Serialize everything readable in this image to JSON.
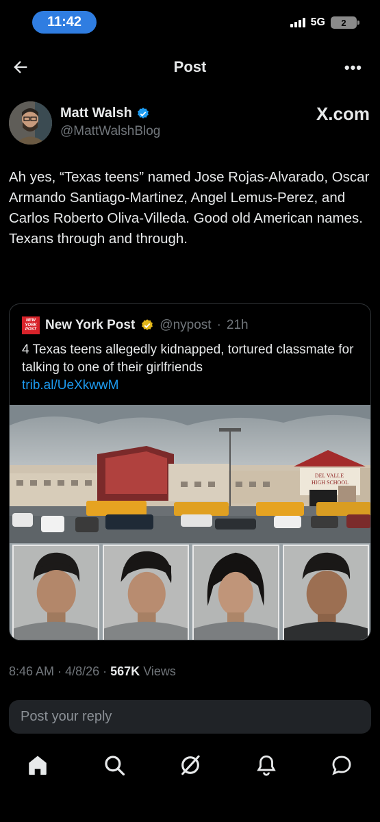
{
  "status_bar": {
    "time": "11:42",
    "network": "5G",
    "battery": "2"
  },
  "nav": {
    "title": "Post"
  },
  "author": {
    "name": "Matt Walsh",
    "handle": "@MattWalshBlog",
    "source_label": "X.com"
  },
  "post": {
    "text": "Ah yes, “Texas teens” named Jose Rojas-Alvarado, Oscar Armando Santiago-Martinez, Angel Lemus-Perez, and Carlos Roberto Oliva-Villeda. Good old American names. Texans through and through."
  },
  "quote": {
    "logo_text": "NEW YORK POST",
    "name": "New York Post",
    "handle": "@nypost",
    "separator": "·",
    "age": "21h",
    "text": "4 Texas teens allegedly kidnapped, tortured classmate for talking to one of their girlfriends",
    "link": "trib.al/UeXkwwM",
    "school_sign": "DEL VALLE HIGH SCHOOL"
  },
  "meta": {
    "time": "8:46 AM",
    "sep1": "·",
    "date": "4/8/26",
    "sep2": "·",
    "views_count": "567K",
    "views_label": "Views"
  },
  "reply": {
    "placeholder": "Post your reply"
  },
  "tabs": [
    "home",
    "search",
    "grok",
    "notifications",
    "messages"
  ],
  "colors": {
    "accent": "#1d9bf0",
    "background": "#000000",
    "muted": "#71767b",
    "nypost_red": "#d8232a",
    "verified_gold": "#e2b719"
  }
}
